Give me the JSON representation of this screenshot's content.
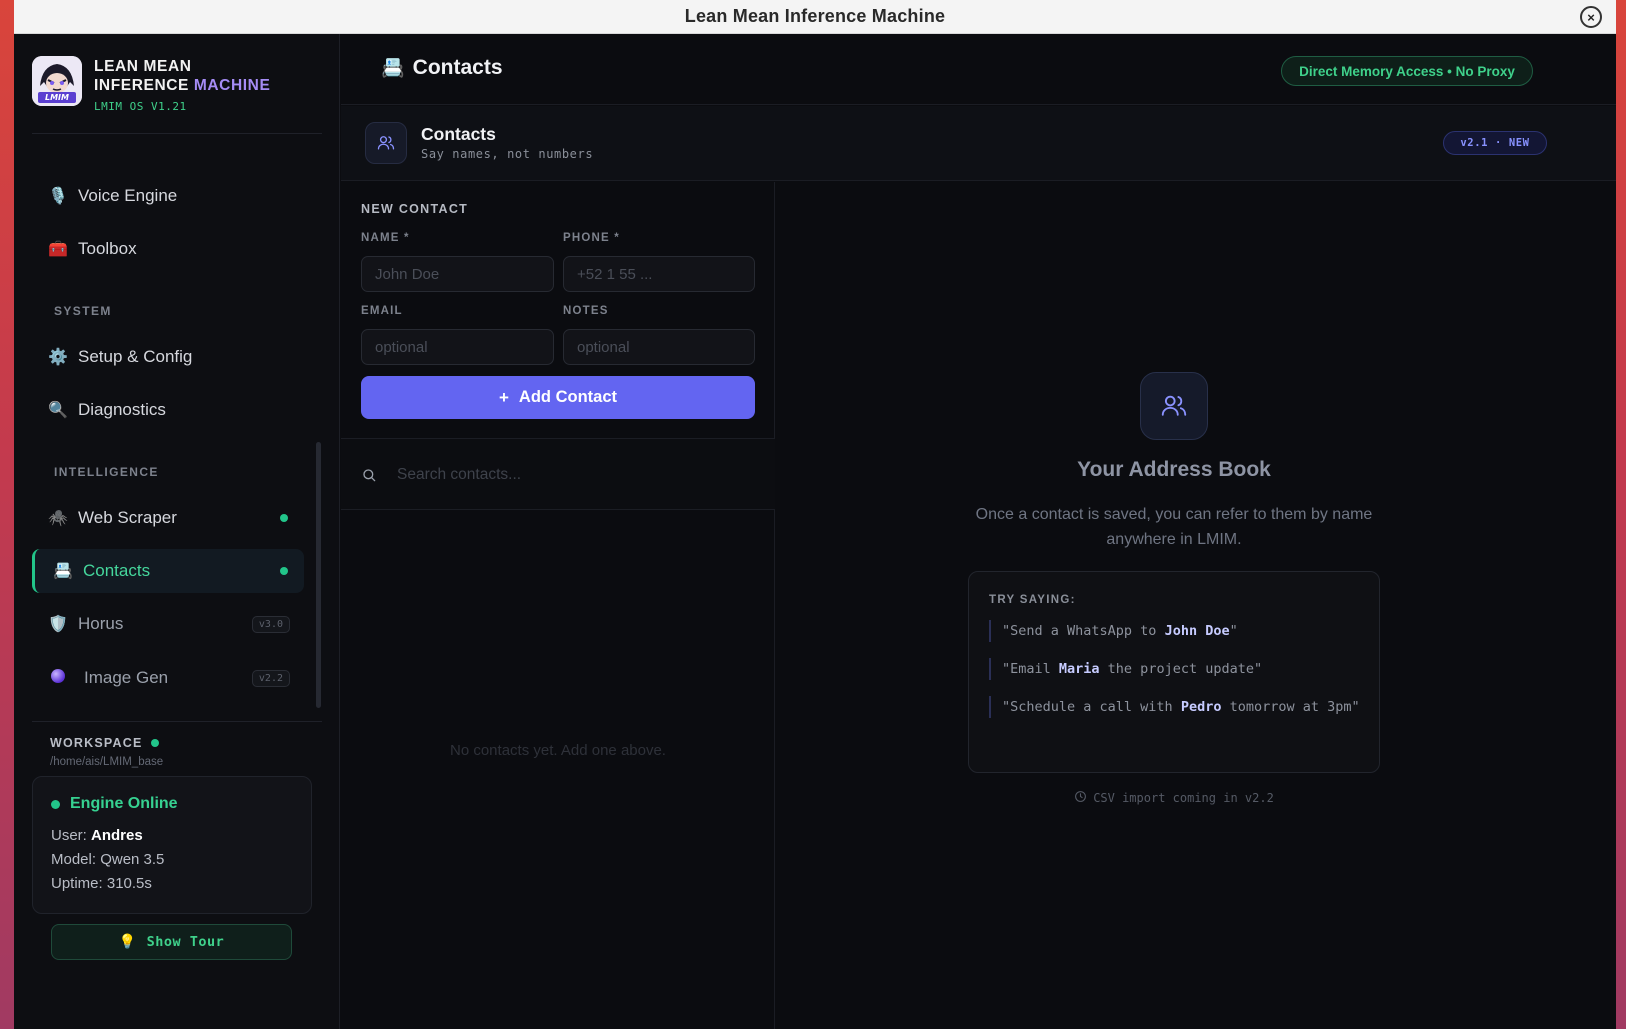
{
  "window": {
    "title": "Lean Mean Inference Machine",
    "close_icon": "×"
  },
  "brand": {
    "line1": "LEAN MEAN",
    "line2a": "INFERENCE ",
    "line2b": "MACHINE",
    "version": "LMIM OS V1.21",
    "logo_text": "LMIM"
  },
  "sidebar": {
    "items_top": [
      {
        "label": "Voice Engine",
        "icon": "🎙️"
      },
      {
        "label": "Toolbox",
        "icon": "🧰"
      }
    ],
    "system_label": "SYSTEM",
    "system_items": [
      {
        "label": "Setup & Config",
        "icon": "⚙️"
      },
      {
        "label": "Diagnostics",
        "icon": "🔍"
      }
    ],
    "intelligence_label": "INTELLIGENCE",
    "intelligence_items": [
      {
        "label": "Web Scraper",
        "icon": "🕷️"
      },
      {
        "label": "Contacts",
        "icon": "📇"
      },
      {
        "label": "Horus",
        "icon": "🛡️",
        "badge": "v3.0"
      },
      {
        "label": "Image Gen",
        "icon": "🟣",
        "badge": "v2.2"
      }
    ],
    "workspace_label": "WORKSPACE",
    "workspace_path": "/home/ais/LMIM_base",
    "engine": {
      "status": "Engine Online",
      "user_label": "User: ",
      "user": "Andres",
      "model": "Model: Qwen 3.5",
      "uptime": "Uptime: 310.5s"
    },
    "tour_button": {
      "icon": "💡",
      "label": "Show Tour"
    }
  },
  "header": {
    "icon": "📇",
    "title": "Contacts",
    "pill": "Direct Memory Access • No Proxy"
  },
  "subheader": {
    "title": "Contacts",
    "tagline": "Say names, not numbers",
    "version": "v2.1 · NEW"
  },
  "form": {
    "title": "NEW CONTACT",
    "name_label": "NAME *",
    "name_placeholder": "John Doe",
    "phone_label": "PHONE *",
    "phone_placeholder": "+52 1 55 ...",
    "email_label": "EMAIL",
    "email_placeholder": "optional",
    "notes_label": "NOTES",
    "notes_placeholder": "optional",
    "add_button": "Add Contact",
    "add_icon": "+"
  },
  "search": {
    "placeholder": "Search contacts..."
  },
  "list": {
    "empty": "No contacts yet. Add one above."
  },
  "address_book": {
    "title": "Your Address Book",
    "description": "Once a contact is saved, you can refer to them by name anywhere in LMIM.",
    "try_label": "TRY SAYING:",
    "examples": [
      {
        "pre": "\"Send a WhatsApp to ",
        "name": "John Doe",
        "post": "\""
      },
      {
        "pre": "\"Email ",
        "name": "Maria",
        "post": " the project update\""
      },
      {
        "pre": "\"Schedule a call with ",
        "name": "Pedro",
        "post": " tomorrow at 3pm\""
      }
    ],
    "csv_note": "CSV import coming in v2.2"
  },
  "colors": {
    "accent": "#6365f1",
    "green": "#22c58a",
    "purple": "#a58cf5"
  }
}
